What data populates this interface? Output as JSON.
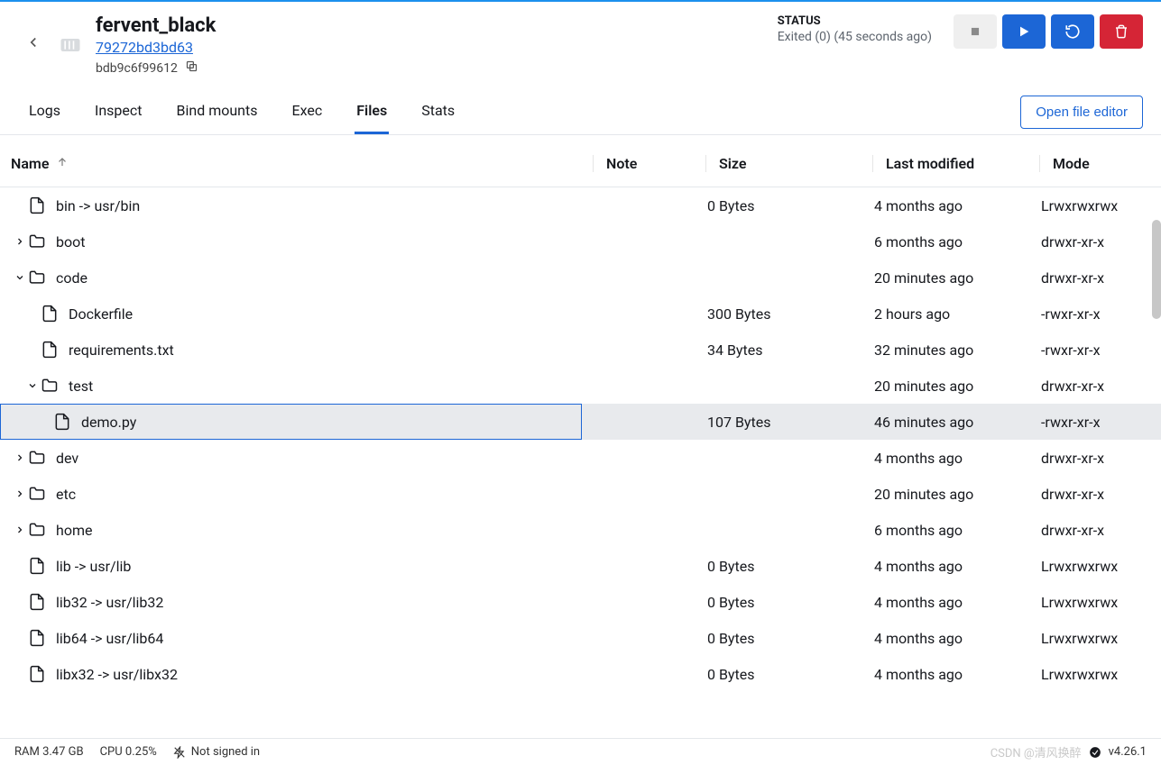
{
  "header": {
    "name": "fervent_black",
    "container_id": "79272bd3bd63",
    "image_id": "bdb9c6f99612",
    "status_label": "STATUS",
    "status_text": "Exited (0) (45 seconds ago)"
  },
  "tabs": {
    "logs": "Logs",
    "inspect": "Inspect",
    "bind_mounts": "Bind mounts",
    "exec": "Exec",
    "files": "Files",
    "stats": "Stats",
    "open_editor": "Open file editor"
  },
  "columns": {
    "name": "Name",
    "note": "Note",
    "size": "Size",
    "modified": "Last modified",
    "mode": "Mode"
  },
  "rows": [
    {
      "indent": 0,
      "expand": "",
      "type": "file",
      "name": "bin -> usr/bin",
      "size": "0 Bytes",
      "modified": "4 months ago",
      "mode": "Lrwxrwxrwx"
    },
    {
      "indent": 0,
      "expand": ">",
      "type": "folder",
      "name": "boot",
      "size": "",
      "modified": "6 months ago",
      "mode": "drwxr-xr-x"
    },
    {
      "indent": 0,
      "expand": "v",
      "type": "folder",
      "name": "code",
      "size": "",
      "modified": "20 minutes ago",
      "mode": "drwxr-xr-x"
    },
    {
      "indent": 1,
      "expand": "",
      "type": "file",
      "name": "Dockerfile",
      "size": "300 Bytes",
      "modified": "2 hours ago",
      "mode": "-rwxr-xr-x"
    },
    {
      "indent": 1,
      "expand": "",
      "type": "file",
      "name": "requirements.txt",
      "size": "34 Bytes",
      "modified": "32 minutes ago",
      "mode": "-rwxr-xr-x"
    },
    {
      "indent": 1,
      "expand": "v",
      "type": "folder",
      "name": "test",
      "size": "",
      "modified": "20 minutes ago",
      "mode": "drwxr-xr-x"
    },
    {
      "indent": 2,
      "expand": "",
      "type": "file",
      "name": "demo.py",
      "size": "107 Bytes",
      "modified": "46 minutes ago",
      "mode": "-rwxr-xr-x",
      "selected": true
    },
    {
      "indent": 0,
      "expand": ">",
      "type": "folder",
      "name": "dev",
      "size": "",
      "modified": "4 months ago",
      "mode": "drwxr-xr-x"
    },
    {
      "indent": 0,
      "expand": ">",
      "type": "folder",
      "name": "etc",
      "size": "",
      "modified": "20 minutes ago",
      "mode": "drwxr-xr-x"
    },
    {
      "indent": 0,
      "expand": ">",
      "type": "folder",
      "name": "home",
      "size": "",
      "modified": "6 months ago",
      "mode": "drwxr-xr-x"
    },
    {
      "indent": 0,
      "expand": "",
      "type": "file",
      "name": "lib -> usr/lib",
      "size": "0 Bytes",
      "modified": "4 months ago",
      "mode": "Lrwxrwxrwx"
    },
    {
      "indent": 0,
      "expand": "",
      "type": "file",
      "name": "lib32 -> usr/lib32",
      "size": "0 Bytes",
      "modified": "4 months ago",
      "mode": "Lrwxrwxrwx"
    },
    {
      "indent": 0,
      "expand": "",
      "type": "file",
      "name": "lib64 -> usr/lib64",
      "size": "0 Bytes",
      "modified": "4 months ago",
      "mode": "Lrwxrwxrwx"
    },
    {
      "indent": 0,
      "expand": "",
      "type": "file",
      "name": "libx32 -> usr/libx32",
      "size": "0 Bytes",
      "modified": "4 months ago",
      "mode": "Lrwxrwxrwx"
    }
  ],
  "footer": {
    "ram": "RAM 3.47 GB",
    "cpu": "CPU 0.25%",
    "signin": "Not signed in",
    "version": "v4.26.1",
    "watermark": "CSDN @清风换醉"
  }
}
